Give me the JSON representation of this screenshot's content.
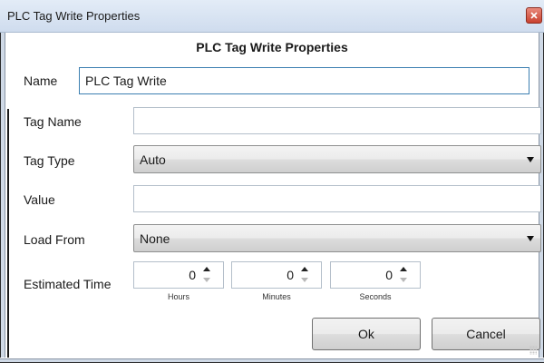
{
  "window": {
    "title": "PLC Tag Write Properties"
  },
  "header": {
    "title": "PLC Tag Write Properties"
  },
  "form": {
    "name": {
      "label": "Name",
      "value": "PLC Tag Write"
    },
    "tag_name": {
      "label": "Tag Name",
      "value": ""
    },
    "tag_type": {
      "label": "Tag Type",
      "selected": "Auto"
    },
    "value": {
      "label": "Value",
      "value": ""
    },
    "load_from": {
      "label": "Load From",
      "selected": "None"
    },
    "estimated_time": {
      "label": "Estimated Time",
      "hours": {
        "value": "0",
        "caption": "Hours"
      },
      "minutes": {
        "value": "0",
        "caption": "Minutes"
      },
      "seconds": {
        "value": "0",
        "caption": "Seconds"
      }
    }
  },
  "buttons": {
    "ok": "Ok",
    "cancel": "Cancel"
  },
  "icons": {
    "close": "close-icon",
    "dropdown": "chevron-down-icon",
    "spin_up": "arrow-up-icon",
    "spin_down": "arrow-down-icon",
    "resize": "resize-grip-icon"
  },
  "colors": {
    "title_bar": "#d8e4f2",
    "close_button": "#c9412f",
    "focus_border": "#3c7fb1"
  }
}
